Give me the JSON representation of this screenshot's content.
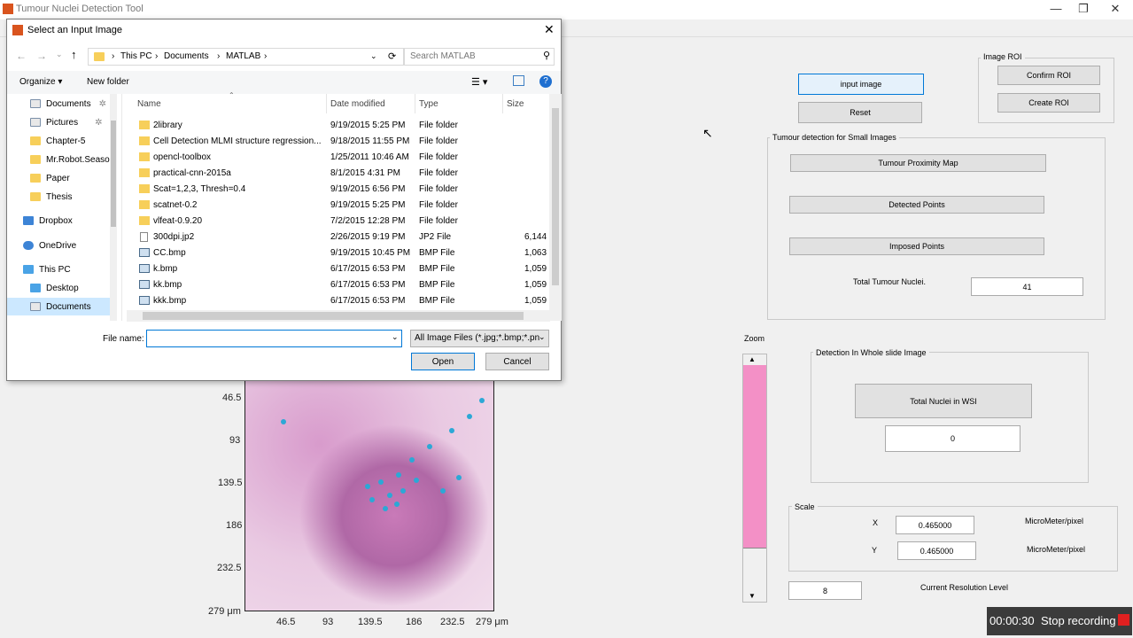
{
  "window": {
    "title": "Tumour Nuclei Detection Tool"
  },
  "buttons": {
    "input_image": "input image",
    "reset": "Reset",
    "confirm_roi": "Confirm ROI",
    "create_roi": "Create ROI",
    "tumour_proximity_map": "Tumour Proximity Map",
    "detected_points": "Detected Points",
    "imposed_points": "Imposed Points",
    "total_nuclei_wsi": "Total Nuclei in WSI"
  },
  "panels": {
    "image_roi": "Image ROI",
    "small_images": "Tumour detection for Small Images",
    "whole_slide": "Detection In Whole slide Image",
    "scale": "Scale"
  },
  "small_images": {
    "total_label": "Total Tumour Nuclei.",
    "total_value": "41"
  },
  "whole_slide": {
    "total_value": "0"
  },
  "scale": {
    "x_label": "X",
    "x_value": "0.465000",
    "x_unit": "MicroMeter/pixel",
    "y_label": "Y",
    "y_value": "0.465000",
    "y_unit": "MicroMeter/pixel"
  },
  "resolution": {
    "value": "8",
    "label": "Current Resolution Level"
  },
  "zoom": {
    "label": "Zoom",
    "level": 0.81
  },
  "axes": {
    "y_ticks": [
      "46.5",
      "93",
      "139.5",
      "186",
      "232.5",
      "279 μm"
    ],
    "x_ticks": [
      "46.5",
      "93",
      "139.5",
      "186",
      "232.5",
      "279 μm"
    ]
  },
  "dialog": {
    "title": "Select an Input Image",
    "breadcrumb": [
      "This PC",
      "Documents",
      "MATLAB"
    ],
    "search_placeholder": "Search MATLAB",
    "organize": "Organize",
    "new_folder": "New folder",
    "nav": [
      {
        "label": "Documents",
        "icon": "documents-icon"
      },
      {
        "label": "Pictures",
        "icon": "pictures-icon"
      },
      {
        "label": "Chapter-5",
        "icon": "folder-icon"
      },
      {
        "label": "Mr.Robot.Seasor",
        "icon": "folder-icon"
      },
      {
        "label": "Paper",
        "icon": "folder-icon"
      },
      {
        "label": "Thesis",
        "icon": "folder-icon"
      },
      {
        "label": "Dropbox",
        "icon": "dropbox-icon"
      },
      {
        "label": "OneDrive",
        "icon": "onedrive-icon"
      },
      {
        "label": "This PC",
        "icon": "pc-icon"
      },
      {
        "label": "Desktop",
        "icon": "desktop-icon"
      },
      {
        "label": "Documents",
        "icon": "documents-icon"
      }
    ],
    "columns": [
      "Name",
      "Date modified",
      "Type",
      "Size"
    ],
    "files": [
      {
        "name": "2library",
        "date": "9/19/2015 5:25 PM",
        "type": "File folder",
        "size": ""
      },
      {
        "name": "Cell Detection MLMI structure regression...",
        "date": "9/18/2015 11:55 PM",
        "type": "File folder",
        "size": ""
      },
      {
        "name": "opencl-toolbox",
        "date": "1/25/2011 10:46 AM",
        "type": "File folder",
        "size": ""
      },
      {
        "name": "practical-cnn-2015a",
        "date": "8/1/2015 4:31 PM",
        "type": "File folder",
        "size": ""
      },
      {
        "name": "Scat=1,2,3, Thresh=0.4",
        "date": "9/19/2015 6:56 PM",
        "type": "File folder",
        "size": ""
      },
      {
        "name": "scatnet-0.2",
        "date": "9/19/2015 5:25 PM",
        "type": "File folder",
        "size": ""
      },
      {
        "name": "vlfeat-0.9.20",
        "date": "7/2/2015 12:28 PM",
        "type": "File folder",
        "size": ""
      },
      {
        "name": "300dpi.jp2",
        "date": "2/26/2015 9:19 PM",
        "type": "JP2 File",
        "size": "6,144 K"
      },
      {
        "name": "CC.bmp",
        "date": "9/19/2015 10:45 PM",
        "type": "BMP File",
        "size": "1,063 K"
      },
      {
        "name": "k.bmp",
        "date": "6/17/2015 6:53 PM",
        "type": "BMP File",
        "size": "1,059 K"
      },
      {
        "name": "kk.bmp",
        "date": "6/17/2015 6:53 PM",
        "type": "BMP File",
        "size": "1,059 K"
      },
      {
        "name": "kkk.bmp",
        "date": "6/17/2015 6:53 PM",
        "type": "BMP File",
        "size": "1,059 K"
      }
    ],
    "filename_label": "File name:",
    "filename_value": "",
    "filter": "All Image Files (*.jpg;*.bmp;*.pn",
    "open": "Open",
    "cancel": "Cancel"
  },
  "recording": {
    "time": "00:00:30",
    "label": "Stop recording"
  }
}
